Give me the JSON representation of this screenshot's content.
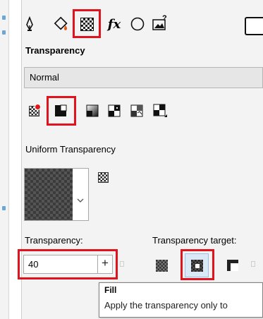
{
  "tabs": {
    "fx_label": "fx",
    "image_glyph": "?"
  },
  "section_title": "Transparency",
  "merge_mode": {
    "value": "Normal"
  },
  "transparency_type_label": "Uniform Transparency",
  "transparency": {
    "label": "Transparency:",
    "value": "40",
    "slider_glyph": "+"
  },
  "target": {
    "label": "Transparency target:"
  },
  "tooltip": {
    "title": "Fill",
    "text": "Apply the transparency only to"
  },
  "highlight_color": "#e0141e",
  "icons": [
    "pen-icon",
    "fill-icon",
    "transparency-icon",
    "effects-icon",
    "circle-icon",
    "image-icon"
  ]
}
